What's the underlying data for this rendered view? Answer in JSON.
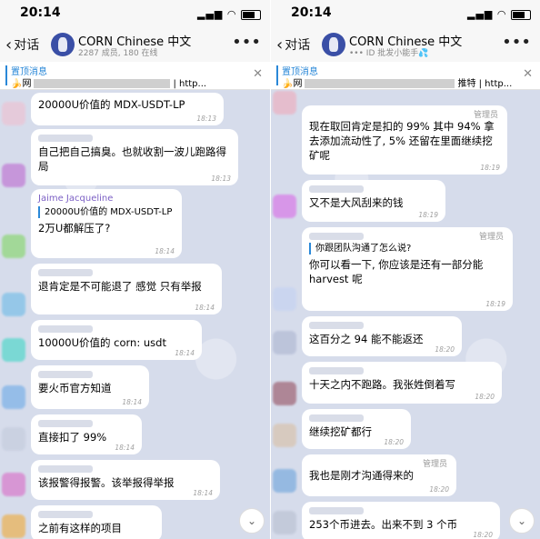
{
  "left": {
    "status_time": "20:14",
    "back_label": "对话",
    "title": "CORN Chinese 中文",
    "subtitle": "2287 成员, 180 在线",
    "pinned_title": "置顶消息",
    "pinned_prefix": "🍌网",
    "pinned_suffix": "| http...",
    "messages": [
      {
        "text": "20000U价值的 MDX-USDT-LP",
        "time": "18:13"
      },
      {
        "text": "自己把自己搞臭。也就收割一波儿跑路得局",
        "time": "18:13"
      },
      {
        "sender": "Jaime Jacqueline",
        "reply": "20000U价值的 MDX-USDT-LP",
        "text": "2万U都解压了?",
        "time": "18:14"
      },
      {
        "text": "退肯定是不可能退了 感觉 只有举报",
        "time": "18:14"
      },
      {
        "text": "10000U价值的 corn: usdt",
        "time": "18:14"
      },
      {
        "text": "要火币官方知道",
        "time": "18:14"
      },
      {
        "text": "直接扣了 99%",
        "time": "18:14"
      },
      {
        "text": "该报警得报警。该举报得举报",
        "time": "18:14"
      },
      {
        "text": "之前有这样的项目",
        "time": ""
      }
    ]
  },
  "right": {
    "status_time": "20:14",
    "back_label": "对话",
    "title": "CORN Chinese 中文",
    "subtitle": "••• ID 批发小能手💦",
    "pinned_title": "置顶消息",
    "pinned_prefix": "🍌网",
    "pinned_suffix": "推特 | http...",
    "messages": [
      {
        "admin": "管理员",
        "text": "现在取回肯定是扣的 99% 其中 94% 拿去添加流动性了, 5% 还留在里面继续挖矿呢",
        "time": "18:19"
      },
      {
        "text": "又不是大风刮来的钱",
        "time": "18:19"
      },
      {
        "admin": "管理员",
        "reply": "你跟团队沟通了怎么说?",
        "text": "你可以看一下, 你应该是还有一部分能 harvest 呢",
        "time": "18:19"
      },
      {
        "text": "这百分之 94 能不能返还",
        "time": "18:20"
      },
      {
        "text": "十天之内不跑路。我张姓倒着写",
        "time": "18:20"
      },
      {
        "text": "继续挖矿都行",
        "time": "18:20"
      },
      {
        "admin": "管理员",
        "text": "我也是刚才沟通得来的",
        "time": "18:20"
      },
      {
        "text": "253个币进去。出来不到 3 个币",
        "time": "18:20"
      }
    ]
  },
  "icons": {
    "back": "chevron-left-icon",
    "more": "more-icon",
    "close": "close-icon",
    "scroll": "chevron-down-icon"
  },
  "colors": {
    "accent": "#2a88d8",
    "bubble": "#ffffff",
    "background": "#d6dceb",
    "sender": "#7b5fc4"
  }
}
